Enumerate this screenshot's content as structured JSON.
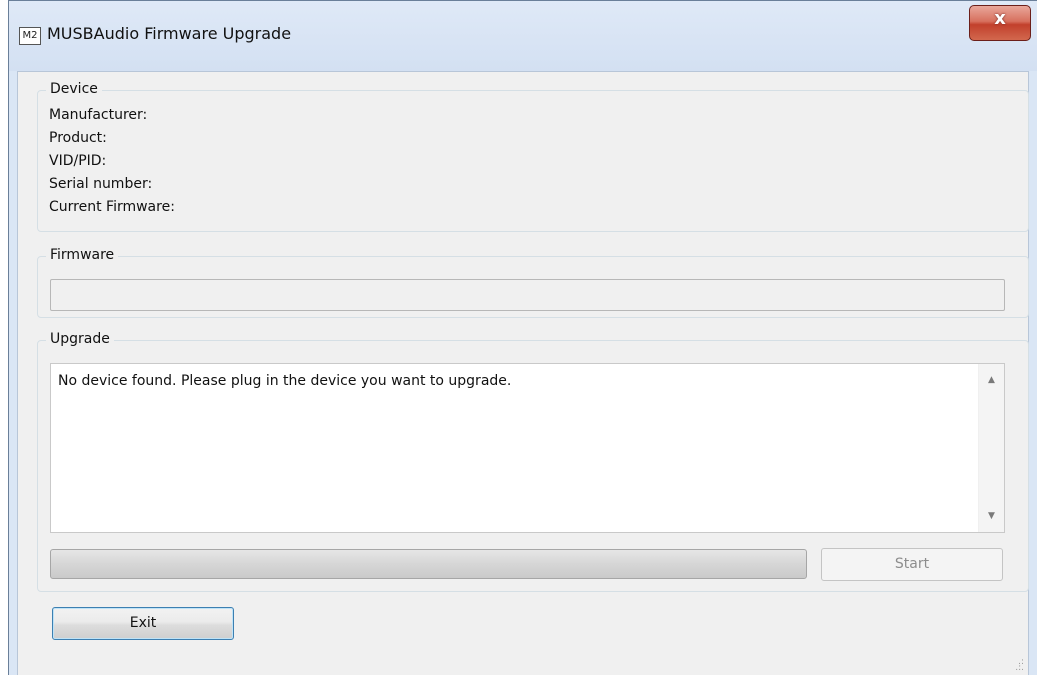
{
  "window": {
    "title": "MUSBAudio Firmware Upgrade",
    "icon_text": "M2",
    "close_glyph": "x",
    "colors": {
      "frame": "#dae6f5",
      "client": "#f0f0f0",
      "close_button": "#c2402c"
    }
  },
  "device": {
    "group_label": "Device",
    "fields": [
      {
        "label": "Manufacturer:"
      },
      {
        "label": "Product:"
      },
      {
        "label": "VID/PID:"
      },
      {
        "label": "Serial number:"
      },
      {
        "label": "Current Firmware:"
      }
    ]
  },
  "firmware": {
    "group_label": "Firmware",
    "value": ""
  },
  "upgrade": {
    "group_label": "Upgrade",
    "log_text": "No device found. Please plug in the device you want to upgrade.",
    "scroll_up_glyph": "▲",
    "scroll_down_glyph": "▼",
    "progress": 0,
    "start_label": "Start",
    "start_enabled": false
  },
  "footer": {
    "exit_label": "Exit",
    "resize_grip_icon": "resize-grip-icon"
  }
}
